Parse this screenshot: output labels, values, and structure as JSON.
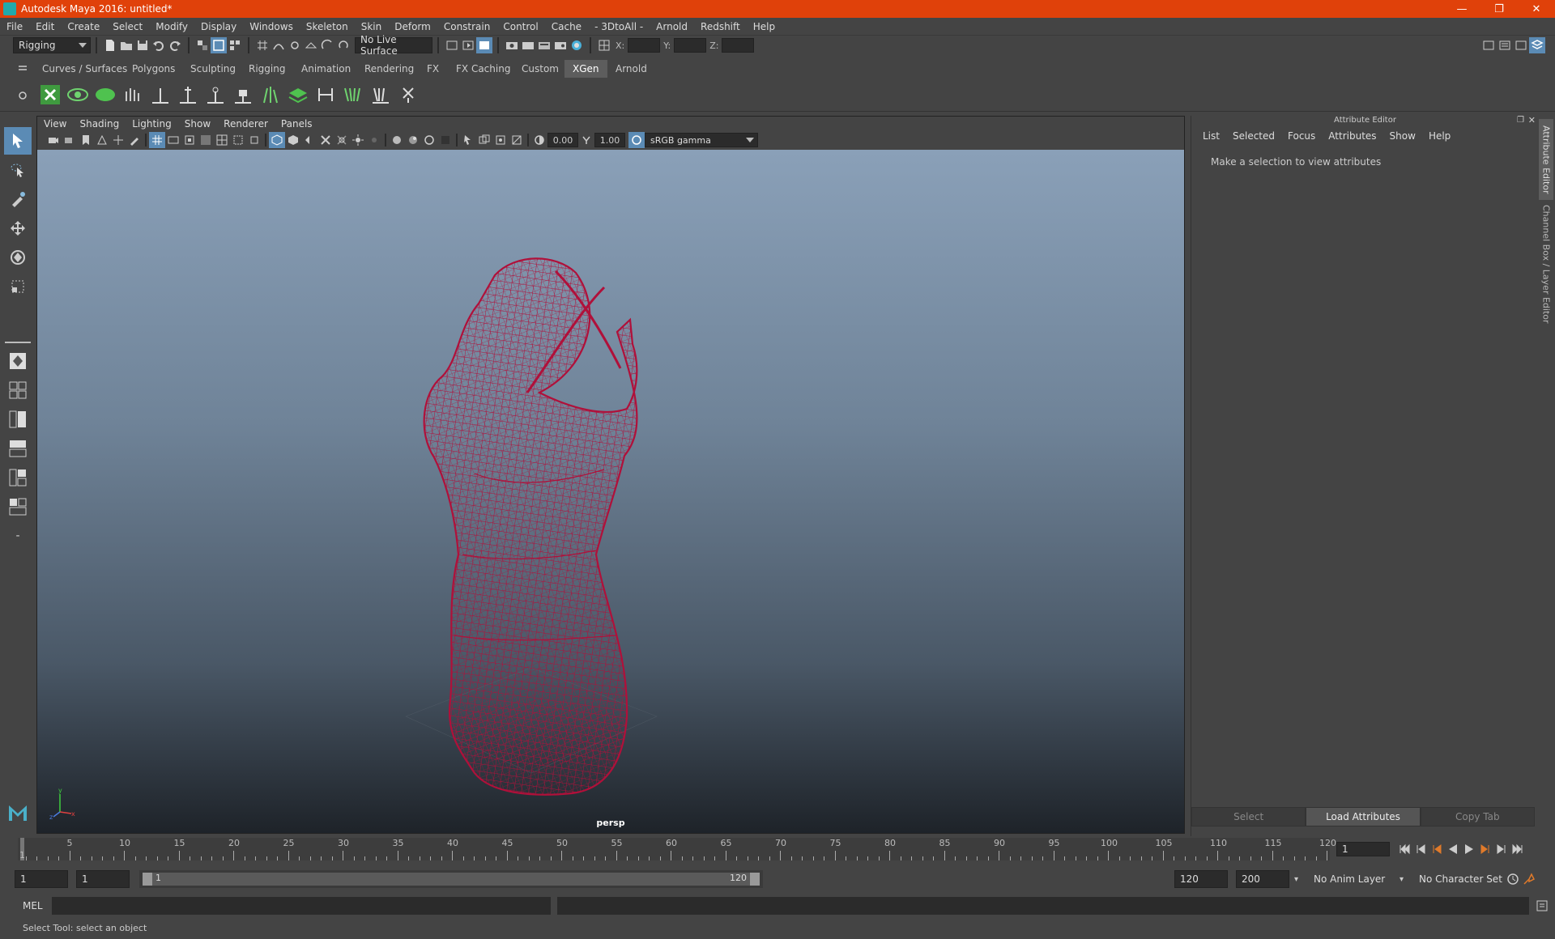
{
  "window": {
    "title": "Autodesk Maya 2016: untitled*"
  },
  "menubar": [
    "File",
    "Edit",
    "Create",
    "Select",
    "Modify",
    "Display",
    "Windows",
    "Skeleton",
    "Skin",
    "Deform",
    "Constrain",
    "Control",
    "Cache",
    "- 3DtoAll -",
    "Arnold",
    "Redshift",
    "Help"
  ],
  "statusline": {
    "menuset": "Rigging",
    "live_surface": "No Live Surface",
    "x_label": "X:",
    "y_label": "Y:",
    "z_label": "Z:"
  },
  "shelf_tabs": [
    "Curves / Surfaces",
    "Polygons",
    "Sculpting",
    "Rigging",
    "Animation",
    "Rendering",
    "FX",
    "FX Caching",
    "Custom",
    "XGen",
    "Arnold"
  ],
  "active_shelf_tab": "XGen",
  "viewport": {
    "menus": [
      "View",
      "Shading",
      "Lighting",
      "Show",
      "Renderer",
      "Panels"
    ],
    "exposure": "0.00",
    "gamma": "1.00",
    "color_space": "sRGB gamma",
    "camera": "persp"
  },
  "attribute_editor": {
    "title": "Attribute Editor",
    "menus": [
      "List",
      "Selected",
      "Focus",
      "Attributes",
      "Show",
      "Help"
    ],
    "message": "Make a selection to view attributes",
    "buttons": {
      "select": "Select",
      "load": "Load Attributes",
      "copy": "Copy Tab"
    },
    "side_tabs": {
      "attribute": "Attribute Editor",
      "channel": "Channel Box / Layer Editor"
    }
  },
  "timeslider": {
    "ticks": [
      "5",
      "10",
      "15",
      "20",
      "25",
      "30",
      "35",
      "40",
      "45",
      "50",
      "55",
      "60",
      "65",
      "70",
      "75",
      "80",
      "85",
      "90",
      "95",
      "100",
      "105",
      "110",
      "115",
      "120"
    ],
    "start_marker": "1",
    "current_frame": "1"
  },
  "range": {
    "start": "1",
    "anim_start": "1",
    "slider_start": "1",
    "slider_end": "120",
    "anim_end": "120",
    "end": "200",
    "anim_layer": "No Anim Layer",
    "character_set": "No Character Set"
  },
  "cmdline": {
    "label": "MEL"
  },
  "helpline": {
    "text": "Select Tool: select an object"
  },
  "colors": {
    "titlebar": "#e0410a",
    "wireframe": "#b0103a",
    "active_tool": "#5b8bb5"
  }
}
